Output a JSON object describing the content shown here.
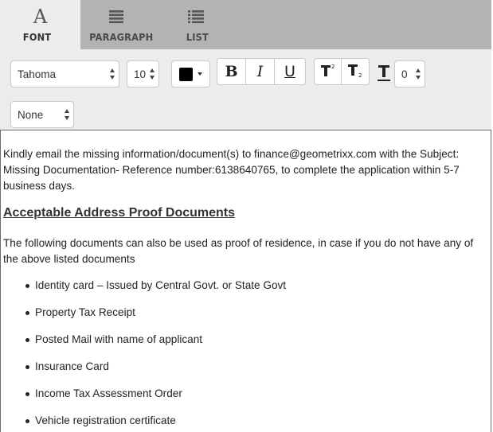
{
  "tabs": {
    "font_label": "FONT",
    "font_glyph": "A",
    "paragraph_label": "PARAGRAPH",
    "list_label": "LIST",
    "active": "font"
  },
  "toolbar": {
    "font_family": "Tahoma",
    "font_size": "10",
    "text_color": "#000000",
    "bold_label": "B",
    "italic_label": "I",
    "underline_label": "U",
    "letter_spacing_value": "0",
    "text_transform": "None"
  },
  "editor": {
    "intro": "Kindly email the missing information/document(s) to finance@geometrixx.com with the Subject: Missing Documentation- Reference number:6138640765, to complete the application within 5-7 business days.",
    "heading": "Acceptable Address Proof Documents",
    "description": "The following documents can also be used as proof of residence, in case if you do not have any of the above listed documents",
    "bullets": [
      "Identity card – Issued by Central Govt. or State Govt",
      "Property Tax Receipt",
      "Posted Mail with name of applicant",
      "Insurance Card",
      "Income Tax Assessment Order",
      "Vehicle registration certificate"
    ]
  },
  "colors": {
    "tabbar_bg": "#b3b3b3",
    "toolbar_bg": "#ececec",
    "active_tab_bg": "#ececec"
  }
}
